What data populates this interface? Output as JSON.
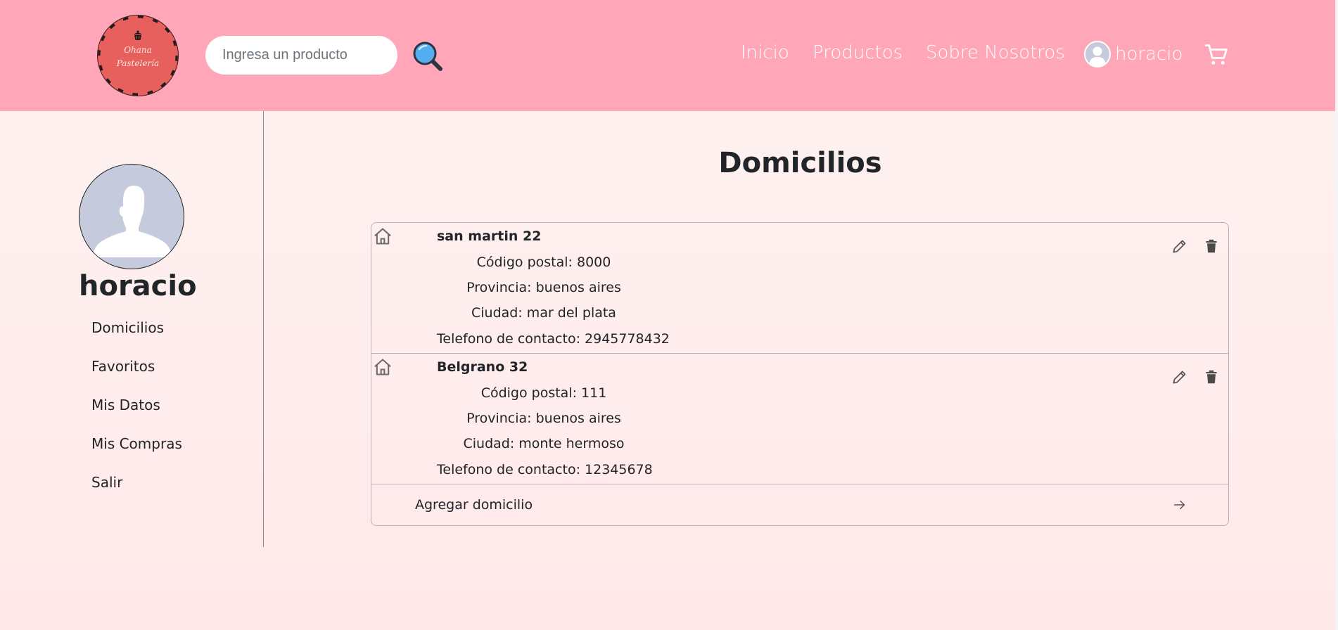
{
  "header": {
    "logo": {
      "line1": "Ohana",
      "line2": "Pastelería"
    },
    "search": {
      "placeholder": "Ingresa un producto"
    },
    "nav": {
      "inicio": "Inicio",
      "productos": "Productos",
      "sobre_nosotros": "Sobre Nosotros",
      "user": "horacio"
    },
    "icons": [
      "search-icon",
      "user-avatar-icon",
      "cart-icon"
    ]
  },
  "sidebar": {
    "profile_name": "horacio",
    "items": [
      {
        "label": "Domicilios"
      },
      {
        "label": "Favoritos"
      },
      {
        "label": "Mis Datos"
      },
      {
        "label": "Mis Compras"
      },
      {
        "label": "Salir"
      }
    ]
  },
  "main": {
    "title": "Domicilios",
    "addresses": [
      {
        "street": "san martin 22",
        "postal": "Código postal: 8000",
        "province": "Provincia: buenos aires",
        "city": "Ciudad: mar del plata",
        "phone": "Telefono de contacto: 2945778432"
      },
      {
        "street": "Belgrano 32",
        "postal": "Código postal: 111",
        "province": "Provincia: buenos aires",
        "city": "Ciudad: monte hermoso",
        "phone": "Telefono de contacto: 12345678"
      }
    ],
    "add_label": "Agregar domicilio"
  },
  "colors": {
    "header_bg": "#ffa6b9",
    "logo_bg": "#e8605d",
    "avatar_bg": "#c5cbdc",
    "text": "#212529",
    "border": "#b5b5b5"
  }
}
